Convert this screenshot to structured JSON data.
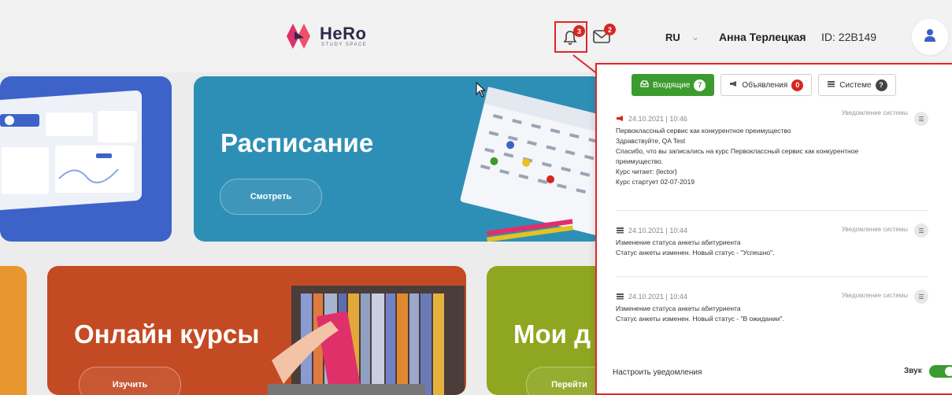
{
  "header": {
    "logo_name": "HeRo",
    "logo_sub": "STUDY SPACE",
    "notifications_count": "3",
    "messages_count": "2",
    "language": "RU",
    "language_caret": "⌄",
    "user_name": "Анна Терлецкая",
    "user_id": "ID: 22B149"
  },
  "cards": {
    "schedule_title": "Расписание",
    "schedule_button": "Смотреть",
    "courses_title": "Онлайн курсы",
    "courses_button": "Изучить",
    "mine_title": "Мои д",
    "mine_button": "Перейти"
  },
  "panel": {
    "tabs": [
      {
        "label": "Входящие",
        "count": "7"
      },
      {
        "label": "Объявления",
        "count": "0"
      },
      {
        "label": "Системе",
        "count": "?"
      }
    ],
    "messages": [
      {
        "date": "24.10.2021 | 10:46",
        "source": "Уведомление системы",
        "lines": [
          "Первоклассный сервис как конкурентное преимущество",
          "Здравствуйте, QA Test",
          "Спасибо, что вы записались на курс Первоклассный сервис как конкурентное",
          "преимущество.",
          "Курс читает: {lector}",
          "Курс стартует 02-07-2019"
        ]
      },
      {
        "date": "24.10.2021 | 10:44",
        "source": "Уведомление системы",
        "lines": [
          "Изменение статуса анкеты абитуриента",
          "Статус анкеты изменен. Новый статус - \"Успешно\"."
        ]
      },
      {
        "date": "24.10.2021 | 10:44",
        "source": "Уведомление системы",
        "lines": [
          "Изменение статуса анкеты абитуриента",
          "Статус анкеты изменен. Новый статус - \"В ожидании\"."
        ]
      }
    ],
    "footer_link": "Настроить уведомления",
    "sound_label": "Звук"
  },
  "colors": {
    "accent_green": "#3c9b2e",
    "highlight_red": "#e0262b",
    "schedule_blue": "#2e8fb6",
    "courses_red": "#c44a23",
    "mine_green": "#8fa620"
  }
}
